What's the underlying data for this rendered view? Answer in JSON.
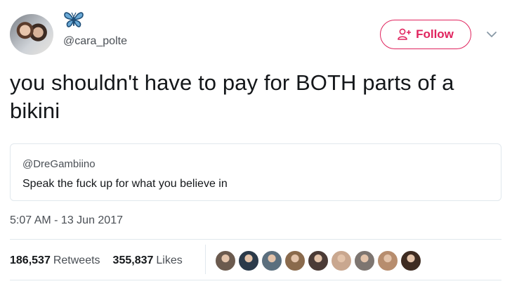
{
  "author": {
    "display_name_icon": "butterfly-icon",
    "handle": "@cara_polte"
  },
  "follow_button": {
    "label": "Follow",
    "icon": "add-user-icon",
    "color": "#e0245e"
  },
  "menu": {
    "icon": "chevron-down-icon"
  },
  "tweet": {
    "text": "you shouldn't have to pay for BOTH parts of a bikini",
    "timestamp": "5:07 AM - 13 Jun 2017"
  },
  "quoted_tweet": {
    "handle": "@DreGambiino",
    "text": "Speak the fuck up for what you believe in"
  },
  "stats": {
    "retweets_count": "186,537",
    "retweets_label": "Retweets",
    "likes_count": "355,837",
    "likes_label": "Likes"
  },
  "likers": [
    {
      "color": "#6b5a4e"
    },
    {
      "color": "#2b3a4a"
    },
    {
      "color": "#5b6f7e"
    },
    {
      "color": "#8a6a4c"
    },
    {
      "color": "#4b3b36"
    },
    {
      "color": "#c9a78f"
    },
    {
      "color": "#7d7570"
    },
    {
      "color": "#b78d6e"
    },
    {
      "color": "#3e2c22"
    }
  ]
}
